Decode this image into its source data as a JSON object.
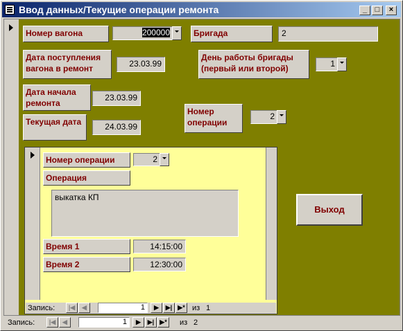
{
  "window": {
    "title": "Ввод данных/Текущие операции ремонта",
    "minimize": "_",
    "maximize": "□",
    "close": "×"
  },
  "form": {
    "wagon_number_label": "Номер вагона",
    "wagon_number_value": "200000",
    "brigade_label": "Бригада",
    "brigade_value": "2",
    "arrival_date_label": "Дата поступления вагона в ремонт",
    "arrival_date_value": "23.03.99",
    "brigade_day_label": "День работы бригады (первый или второй)",
    "brigade_day_value": "1",
    "repair_start_label": "Дата начала ремонта",
    "repair_start_value": "23.03.99",
    "current_date_label": "Текущая дата",
    "current_date_value": "24.03.99",
    "operation_number_label": "Номер операции",
    "operation_number_value": "2",
    "exit_button": "Выход"
  },
  "subform": {
    "operation_number_label": "Номер операции",
    "operation_number_value": "2",
    "operation_label": "Операция",
    "operation_value": "выкатка КП",
    "time1_label": "Время 1",
    "time1_value": "14:15:00",
    "time2_label": "Время 2",
    "time2_value": "12:30:00"
  },
  "subnav": {
    "label": "Запись:",
    "current": "1",
    "of_text": "из",
    "total": "1"
  },
  "mainnav": {
    "label": "Запись:",
    "current": "1",
    "of_text": "из",
    "total": "2"
  },
  "colors": {
    "detail_background": "#7f7f00",
    "subform_background": "#ffff99",
    "label_text": "#800000",
    "title_gradient_start": "#0a246a"
  }
}
